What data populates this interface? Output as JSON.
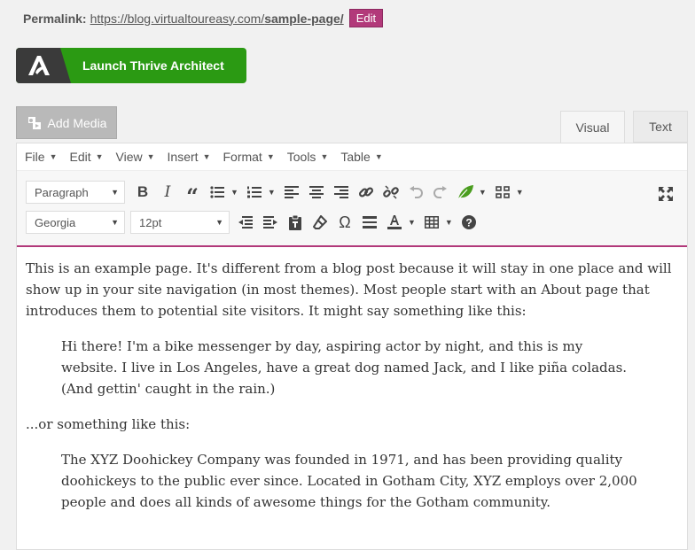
{
  "permalink": {
    "label": "Permalink:",
    "url_base": "https://blog.virtualtoureasy.com/",
    "url_slug": "sample-page/",
    "edit_label": "Edit"
  },
  "thrive": {
    "label": "Launch Thrive Architect"
  },
  "media": {
    "add_label": "Add Media"
  },
  "tabs": {
    "visual": "Visual",
    "text": "Text"
  },
  "menu": [
    "File",
    "Edit",
    "View",
    "Insert",
    "Format",
    "Tools",
    "Table"
  ],
  "toolbar": {
    "block_format": "Paragraph",
    "font_family": "Georgia",
    "font_size": "12pt"
  },
  "content": {
    "p1": "This is an example page. It's different from a blog post because it will stay in one place and will show up in your site navigation (in most themes). Most people start with an About page that introduces them to potential site visitors. It might say something like this:",
    "quote1": "Hi there! I'm a bike messenger by day, aspiring actor by night, and this is my website. I live in Los Angeles, have a great dog named Jack, and I like piña coladas. (And gettin' caught in the rain.)",
    "p2": "...or something like this:",
    "quote2": "The XYZ Doohickey Company was founded in 1971, and has been providing quality doohickeys to the public ever since. Located in Gotham City, XYZ employs over 2,000 people and does all kinds of awesome things for the Gotham community."
  },
  "colors": {
    "accent": "#b2397a",
    "thrive_green": "#2b9a13"
  }
}
